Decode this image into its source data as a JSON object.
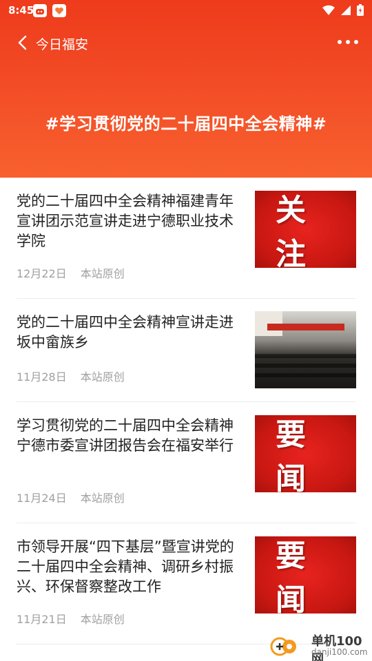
{
  "status_bar": {
    "time": "8:45",
    "app_icons": [
      "notification-app-icon",
      "heart-app-icon"
    ],
    "right_icons": [
      "wifi-icon",
      "signal-icon",
      "battery-icon"
    ]
  },
  "nav": {
    "title": "今日福安",
    "back_icon": "chevron-left-icon",
    "more_icon": "more-dots-icon"
  },
  "banner": {
    "title": "#学习贯彻党的二十届四中全会精神#"
  },
  "articles": [
    {
      "title": "党的二十届四中全会精神福建青年宣讲团示范宣讲走进宁德职业技术学院",
      "date": "12月22日",
      "source": "本站原创",
      "thumb_text": "关注",
      "thumb_kind": "red"
    },
    {
      "title": "党的二十届四中全会精神宣讲走进坂中畲族乡",
      "date": "11月28日",
      "source": "本站原创",
      "thumb_text": "",
      "thumb_kind": "photo"
    },
    {
      "title": "学习贯彻党的二十届四中全会精神宁德市委宣讲团报告会在福安举行",
      "date": "11月24日",
      "source": "本站原创",
      "thumb_text": "要闻",
      "thumb_kind": "red"
    },
    {
      "title": "市领导开展“四下基层”暨宣讲党的二十届四中全会精神、调研乡村振兴、环保督察整改工作",
      "date": "11月21日",
      "source": "本站原创",
      "thumb_text": "要闻",
      "thumb_kind": "red"
    }
  ],
  "watermark": {
    "name": "单机100网",
    "domain": "danji100.com"
  },
  "colors": {
    "header_top": "#ee3b1b",
    "header_bottom": "#f8612e",
    "thumb_red": "#d91d17",
    "meta_gray": "#a0a0a0"
  }
}
